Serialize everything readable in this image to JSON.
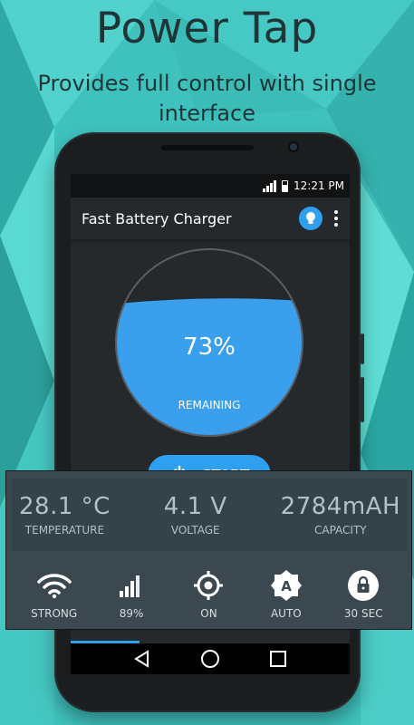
{
  "promo": {
    "title": "Power Tap",
    "subtitle": "Provides full control with single interface"
  },
  "status_bar": {
    "time": "12:21 PM"
  },
  "app": {
    "title": "Fast Battery Charger"
  },
  "gauge": {
    "percent_text": "73%",
    "level": 0.73,
    "label": "REMAINING",
    "fill_color": "#3aa0ee"
  },
  "start_button": {
    "label": "START"
  },
  "stats": [
    {
      "value": "28.1 °C",
      "label": "TEMPERATURE"
    },
    {
      "value": "4.1 V",
      "label": "VOLTAGE"
    },
    {
      "value": "2784mAH",
      "label": "CAPACITY"
    }
  ],
  "toggles": [
    {
      "icon": "wifi-icon",
      "label": "STRONG"
    },
    {
      "icon": "signal-icon",
      "label": "89%"
    },
    {
      "icon": "gps-icon",
      "label": "ON"
    },
    {
      "icon": "auto-brightness-icon",
      "label": "AUTO"
    },
    {
      "icon": "screen-lock-icon",
      "label": "30 SEC"
    }
  ],
  "colors": {
    "accent": "#2f9ff0",
    "background": "#3fc2bd",
    "app_dark": "#26292c"
  }
}
